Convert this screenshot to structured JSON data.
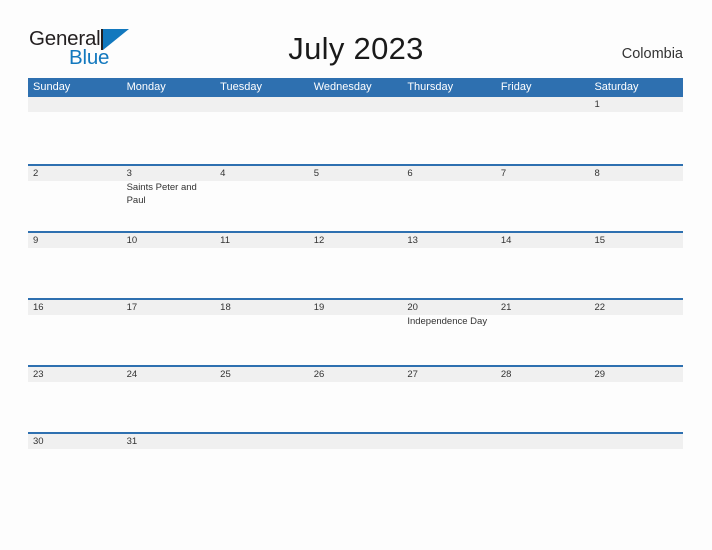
{
  "brand": {
    "name_part1": "General",
    "name_part2": "Blue",
    "flag_icon": "blue-flag-triangle-icon",
    "color_dark": "#231f20",
    "color_blue": "#1278be"
  },
  "header": {
    "title": "July 2023",
    "country": "Colombia"
  },
  "theme": {
    "header_blue": "#2e70b0",
    "band_gray": "#f0f0f0",
    "page_background": "#fdfdfd",
    "text_color": "#333333"
  },
  "calendar": {
    "month": "July",
    "year": "2023",
    "weekdays": [
      "Sunday",
      "Monday",
      "Tuesday",
      "Wednesday",
      "Thursday",
      "Friday",
      "Saturday"
    ],
    "weeks": [
      [
        {
          "day": "",
          "events": []
        },
        {
          "day": "",
          "events": []
        },
        {
          "day": "",
          "events": []
        },
        {
          "day": "",
          "events": []
        },
        {
          "day": "",
          "events": []
        },
        {
          "day": "",
          "events": []
        },
        {
          "day": "1",
          "events": []
        }
      ],
      [
        {
          "day": "2",
          "events": []
        },
        {
          "day": "3",
          "events": [
            "Saints Peter and Paul"
          ]
        },
        {
          "day": "4",
          "events": []
        },
        {
          "day": "5",
          "events": []
        },
        {
          "day": "6",
          "events": []
        },
        {
          "day": "7",
          "events": []
        },
        {
          "day": "8",
          "events": []
        }
      ],
      [
        {
          "day": "9",
          "events": []
        },
        {
          "day": "10",
          "events": []
        },
        {
          "day": "11",
          "events": []
        },
        {
          "day": "12",
          "events": []
        },
        {
          "day": "13",
          "events": []
        },
        {
          "day": "14",
          "events": []
        },
        {
          "day": "15",
          "events": []
        }
      ],
      [
        {
          "day": "16",
          "events": []
        },
        {
          "day": "17",
          "events": []
        },
        {
          "day": "18",
          "events": []
        },
        {
          "day": "19",
          "events": []
        },
        {
          "day": "20",
          "events": [
            "Independence Day"
          ]
        },
        {
          "day": "21",
          "events": []
        },
        {
          "day": "22",
          "events": []
        }
      ],
      [
        {
          "day": "23",
          "events": []
        },
        {
          "day": "24",
          "events": []
        },
        {
          "day": "25",
          "events": []
        },
        {
          "day": "26",
          "events": []
        },
        {
          "day": "27",
          "events": []
        },
        {
          "day": "28",
          "events": []
        },
        {
          "day": "29",
          "events": []
        }
      ],
      [
        {
          "day": "30",
          "events": []
        },
        {
          "day": "31",
          "events": []
        },
        {
          "day": "",
          "events": []
        },
        {
          "day": "",
          "events": []
        },
        {
          "day": "",
          "events": []
        },
        {
          "day": "",
          "events": []
        },
        {
          "day": "",
          "events": []
        }
      ]
    ]
  }
}
